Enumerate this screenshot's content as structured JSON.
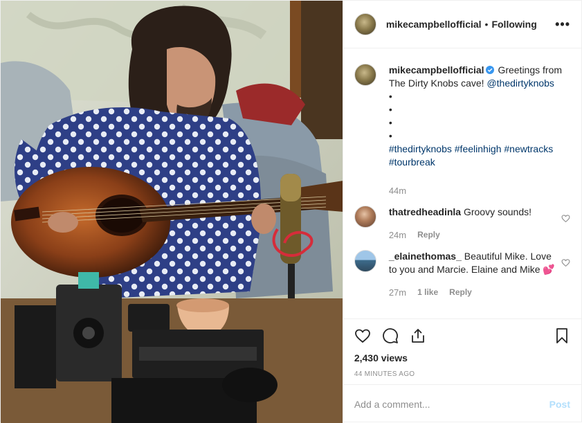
{
  "header": {
    "username": "mikecampbellofficial",
    "separator": "•",
    "follow_status": "Following",
    "more": "•••"
  },
  "caption": {
    "username": "mikecampbellofficial",
    "text": "Greetings from The Dirty Knobs cave!",
    "mention": "@thedirtyknobs",
    "bullets": [
      "•",
      "•",
      "•",
      "•"
    ],
    "hashtags": "#thedirtyknobs #feelinhigh #newtracks #tourbreak",
    "time": "44m"
  },
  "comments": [
    {
      "username": "thatredheadinla",
      "text": "Groovy sounds!",
      "time": "24m",
      "likes": "",
      "reply": "Reply"
    },
    {
      "username": "_elainethomas_",
      "text": "Beautiful Mike. Love to you and Marcie. Elaine and Mike 💕",
      "time": "27m",
      "likes": "1 like",
      "reply": "Reply"
    }
  ],
  "icons": {
    "like": "heart-icon",
    "comment": "comment-icon",
    "share": "share-icon",
    "save": "bookmark-icon",
    "verified": "verified-badge-icon"
  },
  "stats": {
    "views": "2,430 views",
    "posted": "44 MINUTES AGO"
  },
  "composer": {
    "placeholder": "Add a comment...",
    "post_label": "Post"
  },
  "colors": {
    "link": "#00376b",
    "verified": "#3897f0",
    "muted": "#8e8e8e",
    "post_disabled": "#b2dffc"
  }
}
